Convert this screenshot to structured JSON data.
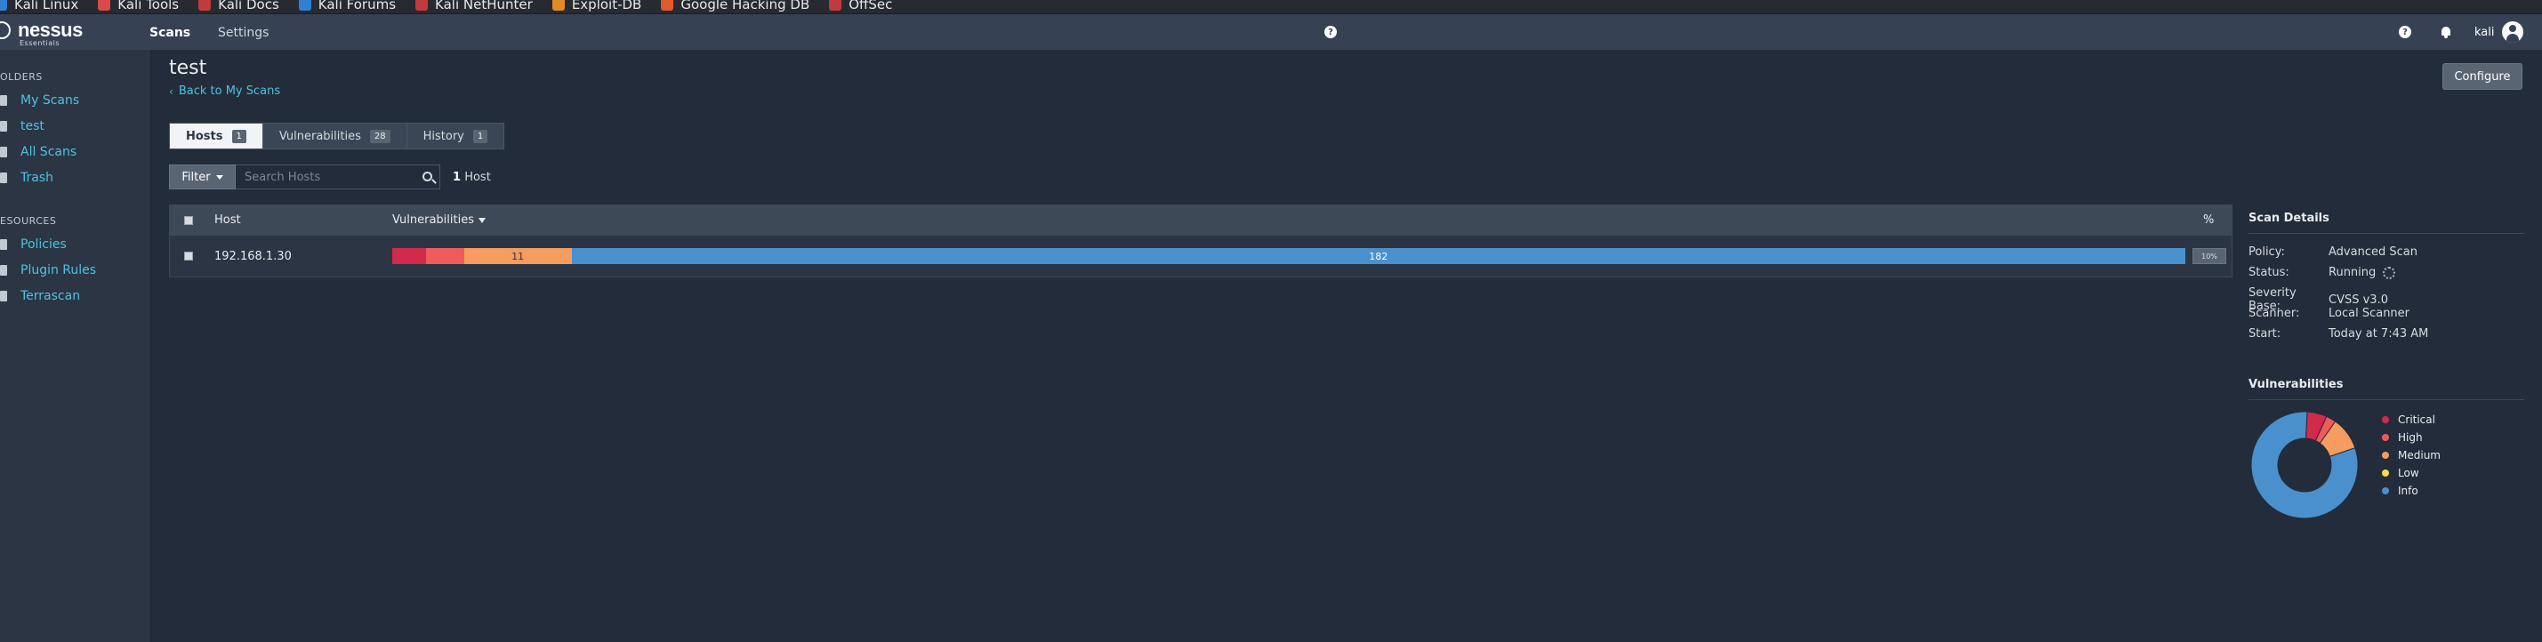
{
  "bookmarks": [
    {
      "label": "Kali Linux",
      "color": "#2f7fd5"
    },
    {
      "label": "Kali Tools",
      "color": "#d94a4a"
    },
    {
      "label": "Kali Docs",
      "color": "#c23b3b"
    },
    {
      "label": "Kali Forums",
      "color": "#2f7fd5"
    },
    {
      "label": "Kali NetHunter",
      "color": "#c23b3b"
    },
    {
      "label": "Exploit-DB",
      "color": "#e08a2a"
    },
    {
      "label": "Google Hacking DB",
      "color": "#e05a2a"
    },
    {
      "label": "OffSec",
      "color": "#c23b3b"
    }
  ],
  "brand": {
    "name": "nessus",
    "edition": "Essentials"
  },
  "nav": {
    "scans": "Scans",
    "settings": "Settings",
    "help_icon": "?",
    "username": "kali"
  },
  "sidebar": {
    "folders_heading": "OLDERS",
    "folders": [
      {
        "label": "My Scans",
        "icon": "folder-icon"
      },
      {
        "label": "test",
        "icon": "folder-icon"
      },
      {
        "label": "All Scans",
        "icon": "folder-icon"
      },
      {
        "label": "Trash",
        "icon": "trash-icon"
      }
    ],
    "resources_heading": "ESOURCES",
    "resources": [
      {
        "label": "Policies",
        "icon": "policies-icon"
      },
      {
        "label": "Plugin Rules",
        "icon": "plugin-rules-icon"
      },
      {
        "label": "Terrascan",
        "icon": "terrascan-icon"
      }
    ]
  },
  "page": {
    "title": "test",
    "back_link": "Back to My Scans",
    "configure": "Configure"
  },
  "tabs": [
    {
      "label": "Hosts",
      "count": "1",
      "active": true
    },
    {
      "label": "Vulnerabilities",
      "count": "28",
      "active": false
    },
    {
      "label": "History",
      "count": "1",
      "active": false
    }
  ],
  "filter": {
    "label": "Filter",
    "search_placeholder": "Search Hosts",
    "host_count_num": "1",
    "host_count_label": "Host"
  },
  "table": {
    "columns": {
      "host": "Host",
      "vulnerabilities": "Vulnerabilities",
      "percent": "%"
    },
    "rows": [
      {
        "host": "192.168.1.30",
        "segments": [
          {
            "severity": "critical",
            "value": "",
            "fraction": 0.019,
            "color": "#d22a4b"
          },
          {
            "severity": "high",
            "value": "",
            "fraction": 0.021,
            "color": "#ee5b5b"
          },
          {
            "severity": "medium",
            "value": "11",
            "fraction": 0.06,
            "color": "#f59c5e"
          },
          {
            "severity": "info",
            "value": "182",
            "fraction": 0.9,
            "color": "#4a90cc"
          }
        ],
        "percent_badge": "10%"
      }
    ]
  },
  "scan_details": {
    "heading": "Scan Details",
    "rows": [
      {
        "key": "Policy:",
        "value": "Advanced Scan"
      },
      {
        "key": "Status:",
        "value": "Running"
      },
      {
        "key": "Severity Base:",
        "value": "CVSS v3.0"
      },
      {
        "key": "Scanner:",
        "value": "Local Scanner"
      },
      {
        "key": "Start:",
        "value": "Today at 7:43 AM"
      }
    ]
  },
  "vulnerabilities_panel": {
    "heading": "Vulnerabilities",
    "legend": [
      {
        "label": "Critical",
        "color": "#d22a4b"
      },
      {
        "label": "High",
        "color": "#ee5b5b"
      },
      {
        "label": "Medium",
        "color": "#f59c5e"
      },
      {
        "label": "Low",
        "color": "#f6d94a"
      },
      {
        "label": "Info",
        "color": "#4a90cc"
      }
    ],
    "chart_data": {
      "type": "pie",
      "labels": [
        "Critical",
        "High",
        "Medium",
        "Low",
        "Info"
      ],
      "values": [
        0.06,
        0.03,
        0.1,
        0.0,
        0.81
      ],
      "colors": [
        "#d22a4b",
        "#ee5b5b",
        "#f59c5e",
        "#f6d94a",
        "#4a90cc"
      ]
    }
  }
}
